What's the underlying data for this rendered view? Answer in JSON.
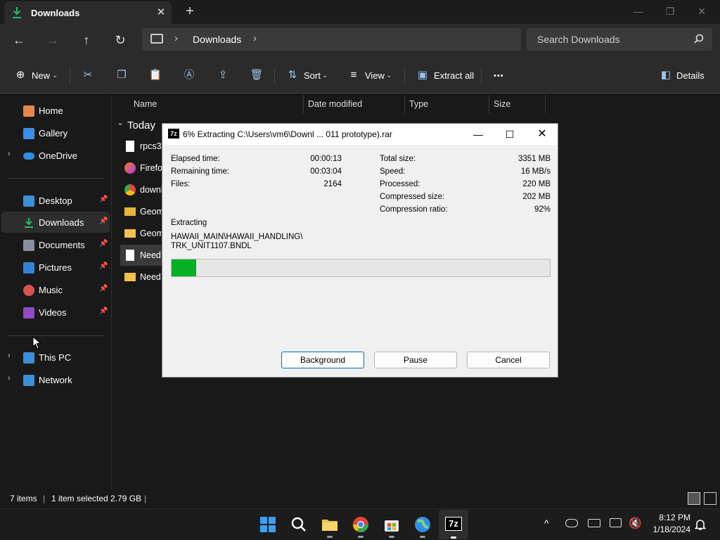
{
  "window": {
    "tab_title": "Downloads",
    "close_tab": "✕",
    "new_tab": "+",
    "minimize": "—",
    "restore": "❐",
    "close": "✕"
  },
  "nav": {
    "back": "←",
    "forward": "→",
    "up": "↑",
    "refresh": "↻",
    "breadcrumb": "Downloads",
    "separator": "›",
    "search_placeholder": "Search Downloads"
  },
  "command_bar": {
    "new_label": "New",
    "sort_label": "Sort",
    "view_label": "View",
    "extract_all_label": "Extract all",
    "more": "•••",
    "details_label": "Details",
    "dropdown_caret": "⌄"
  },
  "sidebar": {
    "quick": [
      {
        "label": "Home",
        "color": "#e8874a"
      },
      {
        "label": "Gallery",
        "color": "#3a8ee6"
      },
      {
        "label": "OneDrive",
        "color": "#2f8ee8"
      }
    ],
    "pinned": [
      {
        "label": "Desktop",
        "color": "#3b8fd9"
      },
      {
        "label": "Downloads",
        "color": "#2bb673"
      },
      {
        "label": "Documents",
        "color": "#8a8fa0"
      },
      {
        "label": "Pictures",
        "color": "#2f86d8"
      },
      {
        "label": "Music",
        "color": "#d9534f"
      },
      {
        "label": "Videos",
        "color": "#8e4bc4"
      }
    ],
    "pin_glyph": "📌",
    "expand_glyph": "›",
    "bottom": [
      {
        "label": "This PC",
        "color": "#3b8fd9"
      },
      {
        "label": "Network",
        "color": "#3b8fd9"
      }
    ]
  },
  "file_list": {
    "columns": [
      "Name",
      "Date modified",
      "Type",
      "Size"
    ],
    "group": "Today",
    "group_chevron": "⌄",
    "rows": [
      {
        "name": "rpcs3-",
        "icon": "file-icon"
      },
      {
        "name": "Firefox",
        "icon": "firefox-icon"
      },
      {
        "name": "downl",
        "icon": "chrome-icon"
      },
      {
        "name": "Geom",
        "icon": "archive-folder-icon"
      },
      {
        "name": "Geom",
        "icon": "folder-icon"
      },
      {
        "name": "Need ",
        "icon": "file-icon"
      },
      {
        "name": "Need ",
        "icon": "folder-icon"
      }
    ]
  },
  "status_bar": {
    "item_count": "7 items",
    "selection": "1 item selected  2.79 GB"
  },
  "dialog": {
    "title": "6% Extracting C:\\Users\\vm6\\Downl ... 011 prototype).rar",
    "icon_text": "7z",
    "left_stats": [
      {
        "label": "Elapsed time:",
        "value": "00:00:13"
      },
      {
        "label": "Remaining time:",
        "value": "00:03:04"
      },
      {
        "label": "Files:",
        "value": "2164"
      }
    ],
    "right_stats": [
      {
        "label": "Total size:",
        "value": "3351 MB"
      },
      {
        "label": "Speed:",
        "value": "16 MB/s"
      },
      {
        "label": "Processed:",
        "value": "220 MB"
      },
      {
        "label": "Compressed size:",
        "value": "202 MB"
      },
      {
        "label": "Compression ratio:",
        "value": "92%"
      }
    ],
    "extracting_label": "Extracting",
    "current_path_line1": "HAWAII_MAIN\\HAWAII_HANDLING\\",
    "current_path_line2": "TRK_UNIT1107.BNDL",
    "progress_fraction": 0.065,
    "progress_color": "#06b025",
    "buttons": {
      "background": "Background",
      "pause": "Pause",
      "cancel": "Cancel"
    }
  },
  "taskbar": {
    "time": "8:12 PM",
    "date": "1/18/2024",
    "tray_caret": "^",
    "app_7z_label": "7z"
  }
}
